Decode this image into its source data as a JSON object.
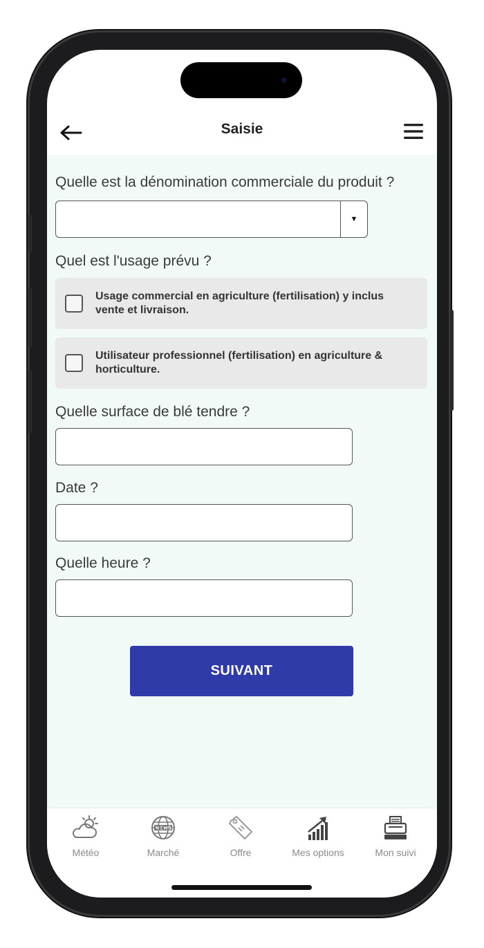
{
  "header": {
    "title": "Saisie",
    "back_icon": "arrow-left-icon",
    "menu_icon": "hamburger-icon"
  },
  "form": {
    "product": {
      "label": "Quelle est la dénomination commerciale du produit ?",
      "value": ""
    },
    "usage": {
      "label": "Quel est l'usage prévu ?",
      "options": [
        {
          "label": "Usage commercial en agriculture (fertilisation) y inclus vente et livraison.",
          "checked": false
        },
        {
          "label": "Utilisateur professionnel (fertilisation) en agriculture & horticulture.",
          "checked": false
        }
      ]
    },
    "surface": {
      "label": "Quelle surface de blé tendre ?",
      "value": ""
    },
    "date": {
      "label": "Date ?",
      "value": ""
    },
    "time": {
      "label": "Quelle heure ?",
      "value": ""
    },
    "submit_label": "SUIVANT"
  },
  "tabbar": {
    "items": [
      {
        "label": "Météo",
        "icon": "weather-icon"
      },
      {
        "label": "Marché",
        "icon": "globe-news-icon"
      },
      {
        "label": "Offre",
        "icon": "price-tag-icon"
      },
      {
        "label": "Mes options",
        "icon": "growth-chart-icon"
      },
      {
        "label": "Mon suivi",
        "icon": "printer-icon"
      }
    ]
  },
  "colors": {
    "primary": "#2f3ba8",
    "content_bg": "#f1faf6",
    "option_bg": "#e9e9e9"
  }
}
